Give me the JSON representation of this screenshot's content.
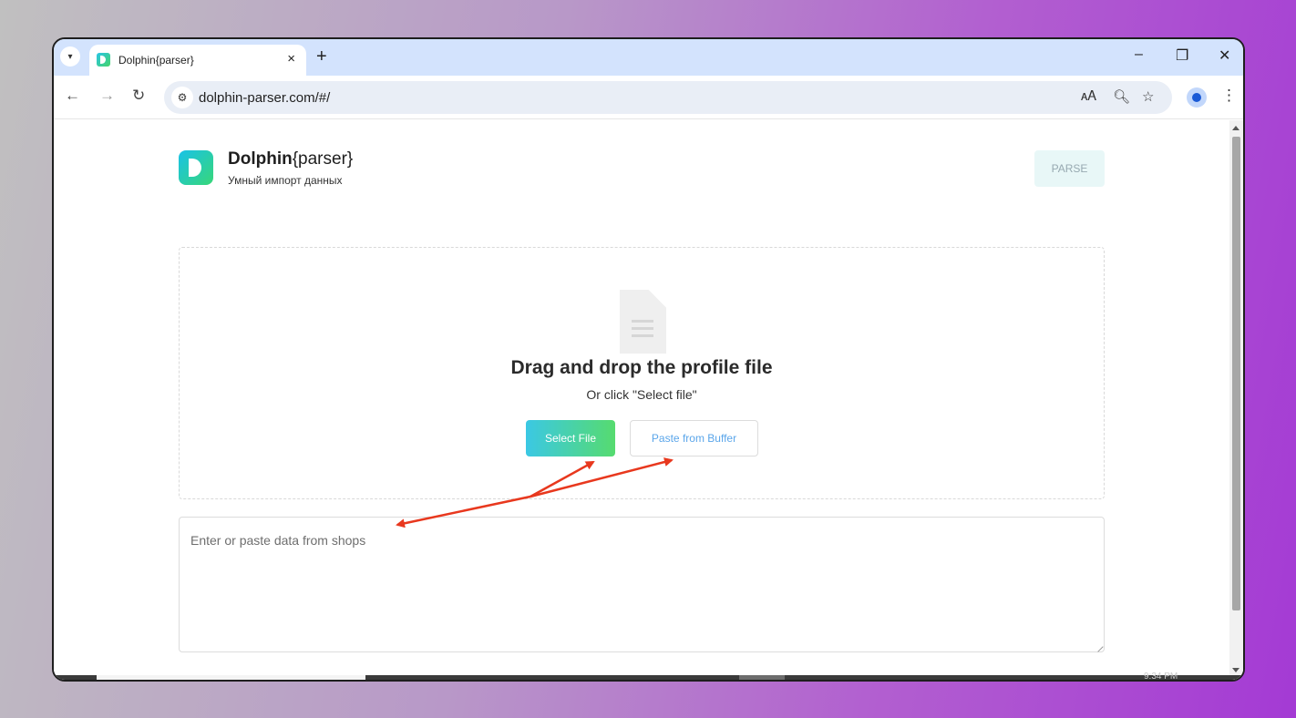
{
  "browser": {
    "tab_title": "Dolphin{parser}",
    "tab_close": "×",
    "new_tab": "+",
    "minimize": "–",
    "restore": "❐",
    "close": "✕",
    "back": "←",
    "forward": "→",
    "reload": "↻",
    "url": "dolphin-parser.com/#/",
    "menu": "⋮"
  },
  "header": {
    "brand_bold": "Dolphin",
    "brand_rest": "{parser}",
    "tagline": "Умный импорт данных",
    "parse_label": "PARSE"
  },
  "dropzone": {
    "title": "Drag and drop the profile file",
    "subtitle": "Or click \"Select file\"",
    "select_label": "Select File",
    "paste_label": "Paste from Buffer"
  },
  "input": {
    "placeholder": "Enter or paste data from shops"
  },
  "taskbar": {
    "clock": "9:34 PM"
  },
  "colors": {
    "annotation_arrow": "#e8381e",
    "accent_start": "#3bc8e4",
    "accent_end": "#56db6f"
  }
}
